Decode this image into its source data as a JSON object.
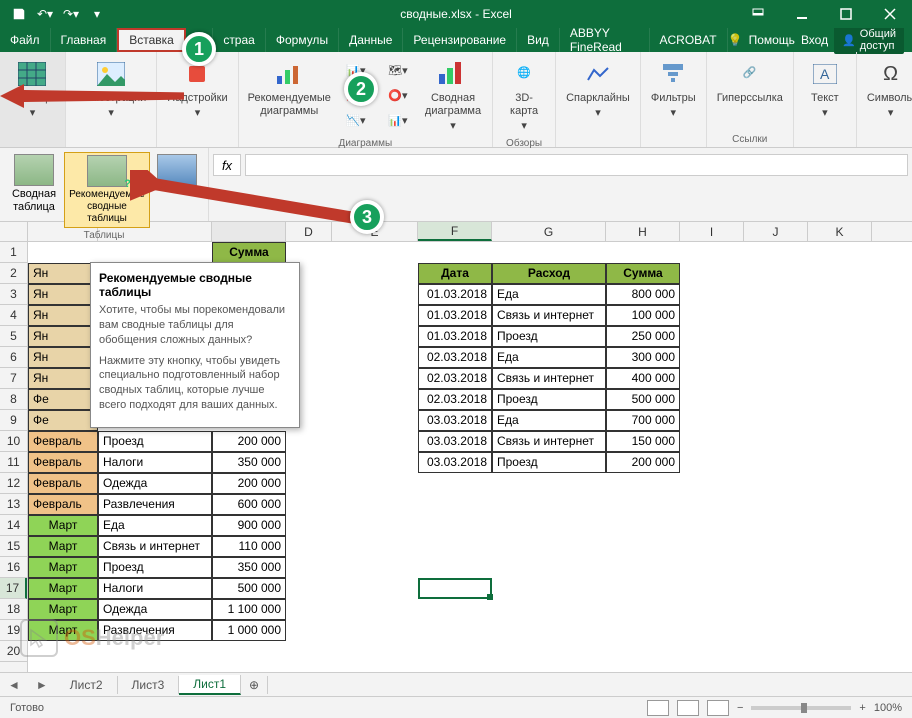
{
  "titlebar": {
    "title": "сводные.xlsx - Excel"
  },
  "tabs": {
    "file": "Файл",
    "home": "Главная",
    "insert": "Вставка",
    "layout": "страа",
    "formulas": "Формулы",
    "data": "Данные",
    "review": "Рецензирование",
    "view": "Вид",
    "abbyy": "ABBYY FineRead",
    "acrobat": "ACROBAT",
    "help": "Помощь",
    "login": "Вход",
    "share": "Общий доступ"
  },
  "ribbon": {
    "tables": "Таблицы",
    "illustrations": "Иллюстрации",
    "addins": "Надстройки",
    "rec_charts": "Рекомендуемые диаграммы",
    "pivot_chart": "Сводная диаграмма",
    "map3d": "3D-карта",
    "sparklines": "Спарклайны",
    "filters": "Фильтры",
    "hyperlink": "Гиперссылка",
    "text": "Текст",
    "symbols": "Символы",
    "g_charts": "Диаграммы",
    "g_reviews": "Обзоры",
    "g_links": "Ссылки"
  },
  "subribbon": {
    "pivot": "Сводная таблица",
    "rec_pivot": "Рекомендуемые сводные таблицы",
    "group": "Таблицы"
  },
  "tooltip": {
    "title": "Рекомендуемые сводные таблицы",
    "p1": "Хотите, чтобы мы порекомендовали вам сводные таблицы для обобщения сложных данных?",
    "p2": "Нажмите эту кнопку, чтобы увидеть специально подготовленный набор сводных таблиц, которые лучше всего подходят для ваших данных."
  },
  "columns": [
    "D",
    "E",
    "F",
    "G",
    "H",
    "I",
    "J",
    "K"
  ],
  "table1": {
    "hdr_sum": "Сумма",
    "rows": [
      {
        "r": 2,
        "m": "Ян",
        "a": ""
      },
      {
        "r": 3,
        "m": "Ян",
        "a": ""
      },
      {
        "r": 4,
        "m": "Ян",
        "a": ""
      },
      {
        "r": 5,
        "m": "Ян",
        "a": ""
      },
      {
        "r": 6,
        "m": "Ян",
        "a": ""
      },
      {
        "r": 7,
        "m": "Ян",
        "a": ""
      },
      {
        "r": 8,
        "m": "Фе",
        "a": ""
      },
      {
        "r": 9,
        "m": "Фе",
        "a": ""
      },
      {
        "r": 10,
        "m": "Февраль",
        "b": "Проезд",
        "c": "200 000",
        "cls": "feb"
      },
      {
        "r": 11,
        "m": "Февраль",
        "b": "Налоги",
        "c": "350 000",
        "cls": "feb"
      },
      {
        "r": 12,
        "m": "Февраль",
        "b": "Одежда",
        "c": "200 000",
        "cls": "feb"
      },
      {
        "r": 13,
        "m": "Февраль",
        "b": "Развлечения",
        "c": "600 000",
        "cls": "feb"
      },
      {
        "r": 14,
        "m": "Март",
        "b": "Еда",
        "c": "900 000",
        "cls": "mar"
      },
      {
        "r": 15,
        "m": "Март",
        "b": "Связь и интернет",
        "c": "110 000",
        "cls": "mar"
      },
      {
        "r": 16,
        "m": "Март",
        "b": "Проезд",
        "c": "350 000",
        "cls": "mar"
      },
      {
        "r": 17,
        "m": "Март",
        "b": "Налоги",
        "c": "500 000",
        "cls": "mar"
      },
      {
        "r": 18,
        "m": "Март",
        "b": "Одежда",
        "c": "1 100 000",
        "cls": "mar"
      },
      {
        "r": 19,
        "m": "Март",
        "b": "Развлечения",
        "c": "1 000 000",
        "cls": "mar"
      }
    ]
  },
  "table2": {
    "hdr_date": "Дата",
    "hdr_expense": "Расход",
    "hdr_sum": "Сумма",
    "rows": [
      {
        "d": "01.03.2018",
        "e": "Еда",
        "s": "800 000"
      },
      {
        "d": "01.03.2018",
        "e": "Связь и интернет",
        "s": "100 000"
      },
      {
        "d": "01.03.2018",
        "e": "Проезд",
        "s": "250 000"
      },
      {
        "d": "02.03.2018",
        "e": "Еда",
        "s": "300 000"
      },
      {
        "d": "02.03.2018",
        "e": "Связь и интернет",
        "s": "400 000"
      },
      {
        "d": "02.03.2018",
        "e": "Проезд",
        "s": "500 000"
      },
      {
        "d": "03.03.2018",
        "e": "Еда",
        "s": "700 000"
      },
      {
        "d": "03.03.2018",
        "e": "Связь и интернет",
        "s": "150 000"
      },
      {
        "d": "03.03.2018",
        "e": "Проезд",
        "s": "200 000"
      }
    ]
  },
  "sheets": {
    "s1": "Лист2",
    "s2": "Лист3",
    "s3": "Лист1"
  },
  "status": {
    "ready": "Готово",
    "zoom": "100%"
  },
  "watermark": {
    "os": "OS",
    "helper": "Helper"
  },
  "callouts": {
    "c1": "1",
    "c2": "2",
    "c3": "3"
  }
}
